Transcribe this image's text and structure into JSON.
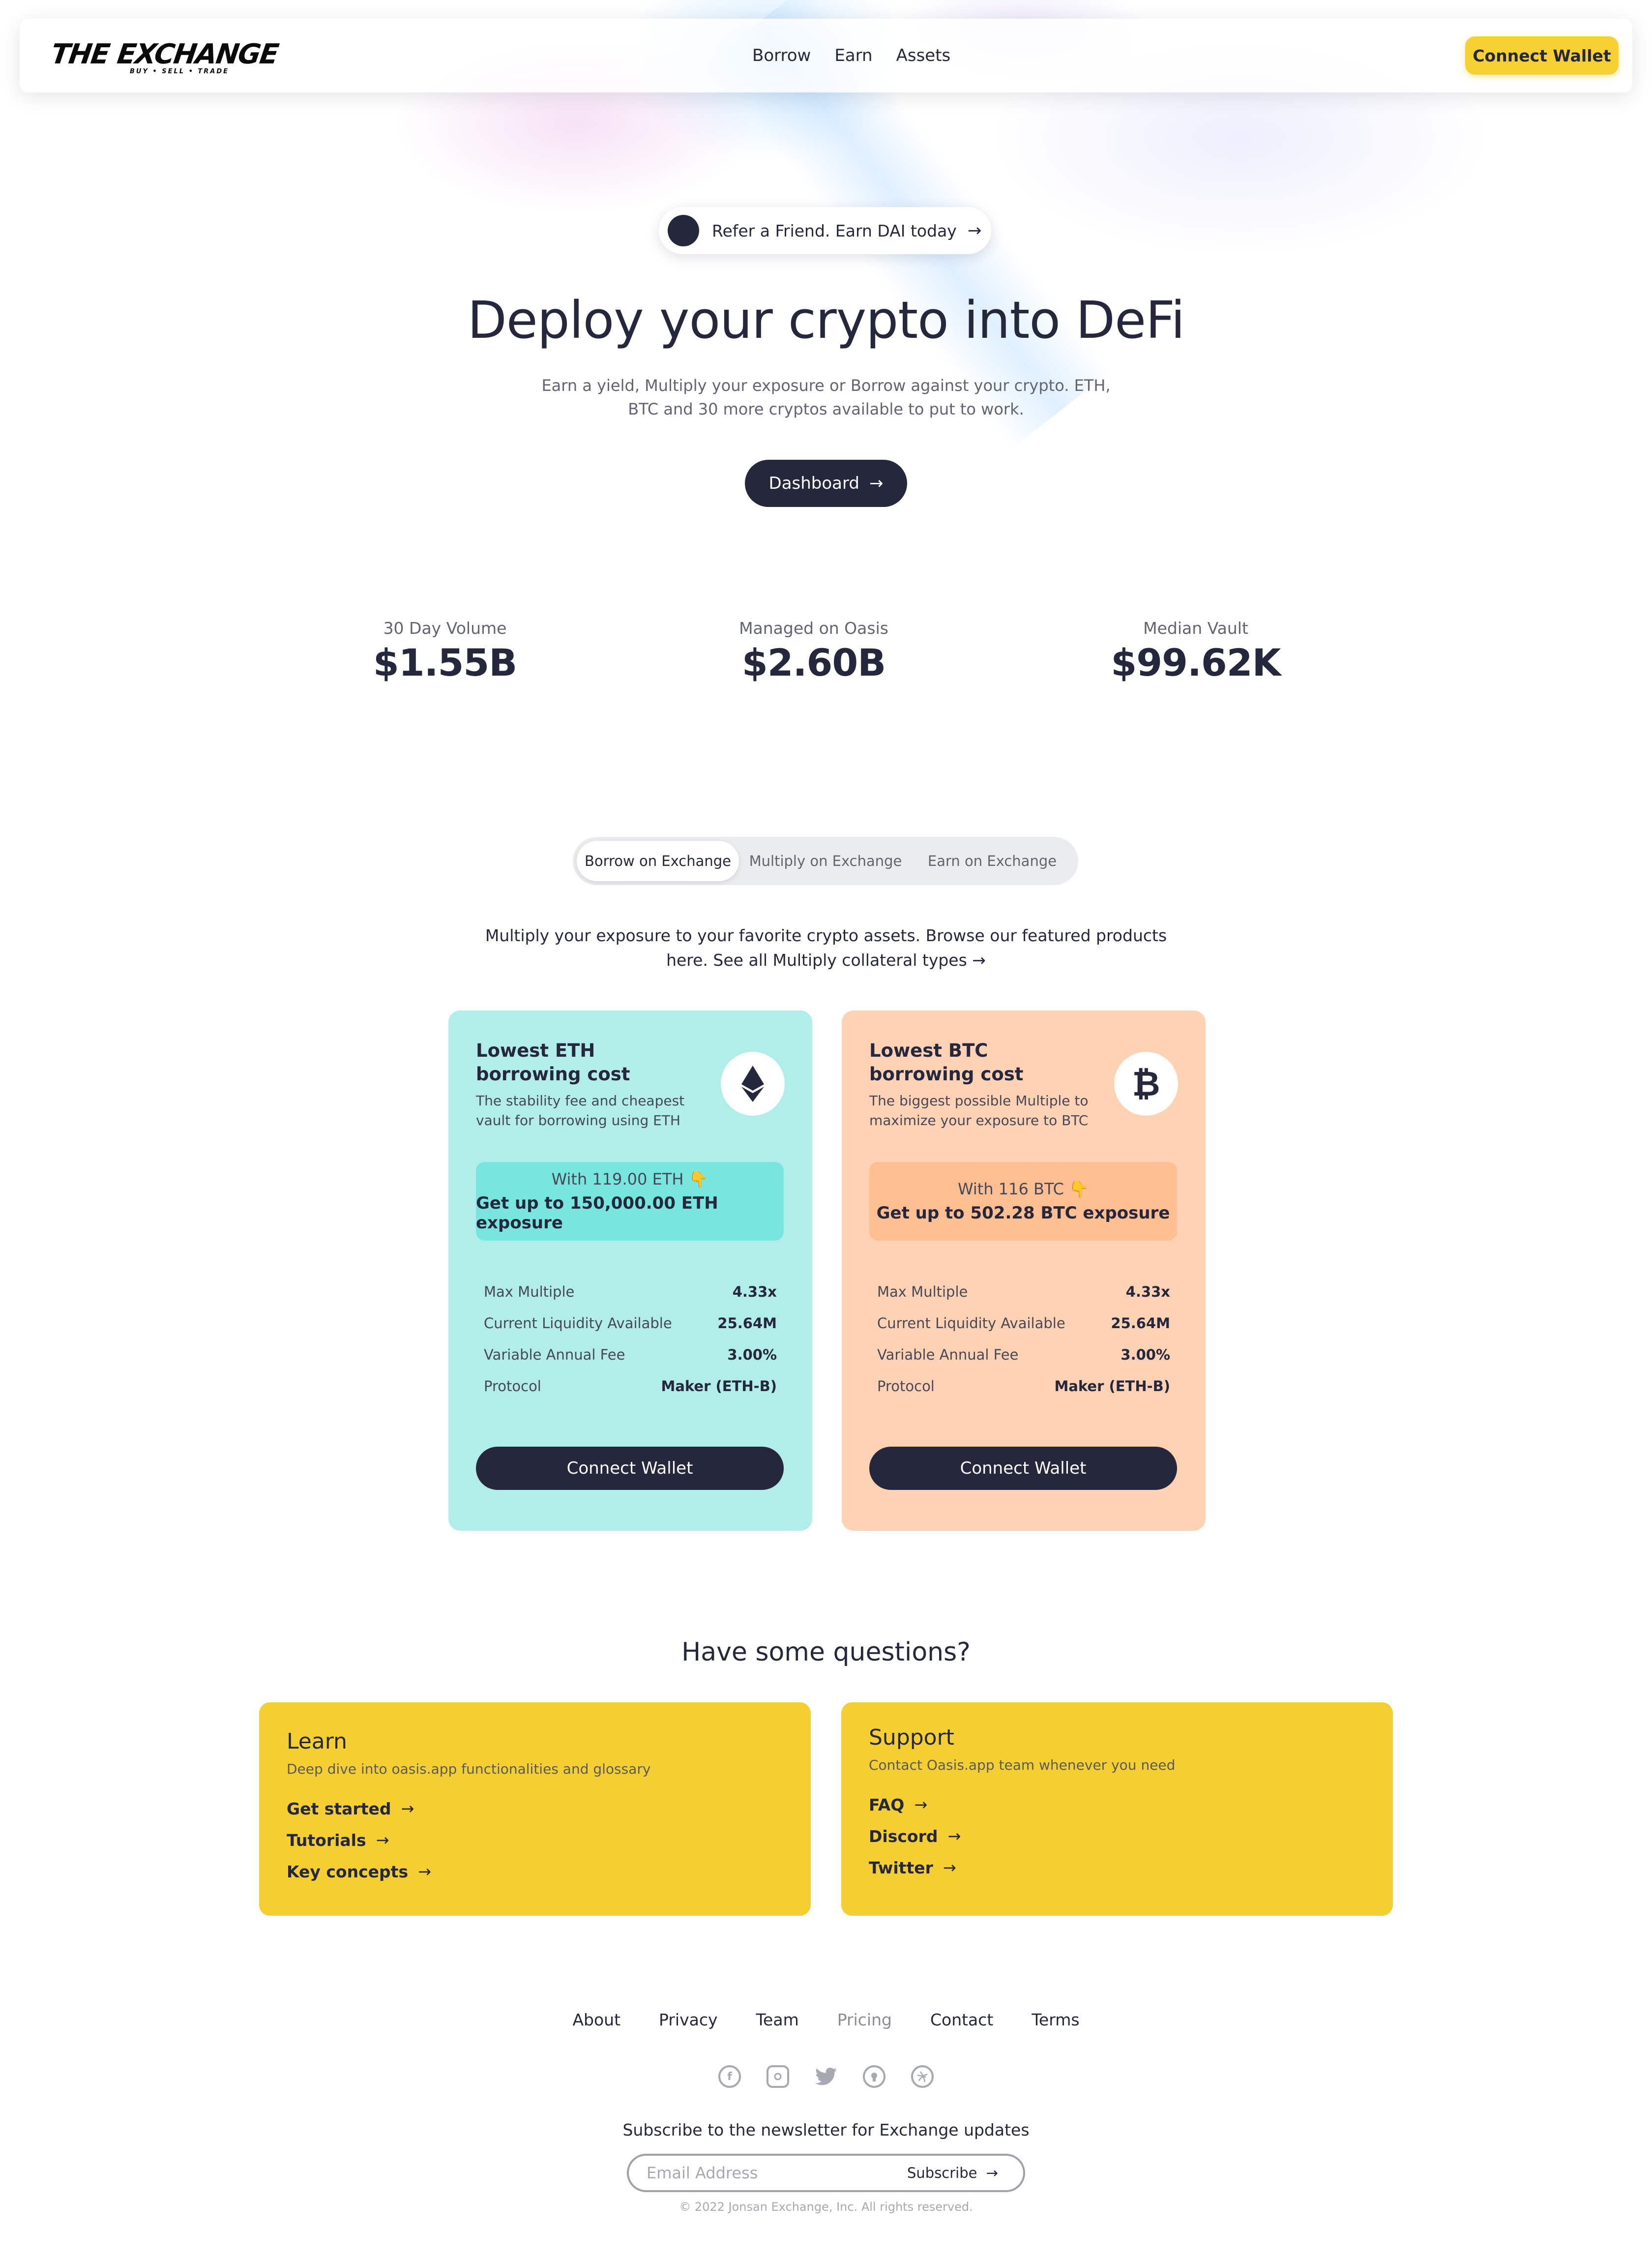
{
  "header": {
    "logo_main": "THE EXCHANGE",
    "logo_sub": "BUY • SELL • TRADE",
    "nav": [
      "Borrow",
      "Earn",
      "Assets"
    ],
    "connect_label": "Connect Wallet"
  },
  "hero": {
    "refer_text": "Refer a Friend. Earn DAI today",
    "title": "Deploy your crypto into DeFi",
    "subtitle": "Earn a yield, Multiply your exposure or Borrow against your crypto. ETH, BTC and 30 more cryptos available to put to work.",
    "cta_label": "Dashboard"
  },
  "stats": [
    {
      "label": "30 Day Volume",
      "value": "$1.55B"
    },
    {
      "label": "Managed on Oasis",
      "value": "$2.60B"
    },
    {
      "label": "Median Vault",
      "value": "$99.62K"
    }
  ],
  "tabs": {
    "items": [
      "Borrow on Exchange",
      "Multiply on Exchange",
      "Earn on Exchange"
    ],
    "active_index": 0,
    "description": "Multiply your exposure to your favorite crypto assets. Browse our featured products here. See all Multiply collateral types →"
  },
  "cards": [
    {
      "title": "Lowest ETH borrowing cost",
      "description": "The stability fee and cheapest vault for borrowing using ETH",
      "icon": "ethereum-icon",
      "highlight_line1": "With 119.00 ETH 👇",
      "highlight_line2": "Get up to 150,000.00 ETH exposure",
      "rows": [
        {
          "label": "Max Multiple",
          "value": "4.33x"
        },
        {
          "label": "Current Liquidity Available",
          "value": "25.64M"
        },
        {
          "label": "Variable Annual Fee",
          "value": "3.00%"
        },
        {
          "label": "Protocol",
          "value": "Maker (ETH-B)"
        }
      ],
      "button_label": "Connect Wallet",
      "bg_color": "#b1ede9"
    },
    {
      "title": "Lowest BTC borrowing cost",
      "description": "The biggest possible Multiple to maximize your exposure to BTC",
      "icon": "bitcoin-icon",
      "highlight_line1": "With 116 BTC 👇",
      "highlight_line2": "Get up to 502.28 BTC exposure",
      "rows": [
        {
          "label": "Max Multiple",
          "value": "4.33x"
        },
        {
          "label": "Current Liquidity Available",
          "value": "25.64M"
        },
        {
          "label": "Variable Annual Fee",
          "value": "3.00%"
        },
        {
          "label": "Protocol",
          "value": "Maker (ETH-B)"
        }
      ],
      "button_label": "Connect Wallet",
      "bg_color": "#fed2b3"
    }
  ],
  "questions": {
    "title": "Have some questions?",
    "learn": {
      "title": "Learn",
      "description": "Deep dive into oasis.app functionalities and glossary",
      "links": [
        "Get started",
        "Tutorials",
        "Key concepts"
      ]
    },
    "support": {
      "title": "Support",
      "description": "Contact Oasis.app team whenever you need",
      "links": [
        "FAQ",
        "Discord",
        "Twitter"
      ]
    }
  },
  "footer": {
    "nav": [
      "About",
      "Privacy",
      "Team",
      "Pricing",
      "Contact",
      "Terms"
    ],
    "socials": [
      "facebook-icon",
      "instagram-icon",
      "twitter-icon",
      "github-icon",
      "dribbble-icon"
    ],
    "newsletter_title": "Subscribe to the newsletter for Exchange updates",
    "email_placeholder": "Email Address",
    "subscribe_label": "Subscribe",
    "copyright": "© 2022 Jonsan Exchange, Inc. All rights reserved."
  },
  "colors": {
    "brand_dark": "#25273d",
    "accent_yellow": "#f7d033",
    "eth_card": "#b1ede9",
    "btc_card": "#fed2b3"
  }
}
